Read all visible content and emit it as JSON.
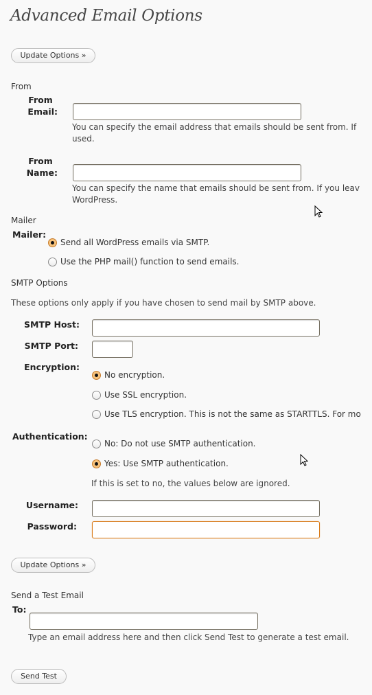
{
  "page": {
    "title": "Advanced Email Options"
  },
  "buttons": {
    "update_options_top": "Update Options »",
    "update_options_bottom": "Update Options »",
    "send_test": "Send Test"
  },
  "from_section": {
    "heading": "From",
    "from_email": {
      "label_line1": "From",
      "label_line2": "Email:",
      "value": "",
      "desc_line1": "You can specify the email address that emails should be sent from. If",
      "desc_line2": "used."
    },
    "from_name": {
      "label_line1": "From",
      "label_line2": "Name:",
      "value": "",
      "desc_line1": "You can specify the name that emails should be sent from. If you leav",
      "desc_line2": "WordPress."
    }
  },
  "mailer_section": {
    "heading": "Mailer",
    "label": "Mailer:",
    "options": [
      {
        "label": "Send all WordPress emails via SMTP.",
        "checked": true
      },
      {
        "label": "Use the PHP mail() function to send emails.",
        "checked": false
      }
    ]
  },
  "smtp_section": {
    "heading": "SMTP Options",
    "intro": "These options only apply if you have chosen to send mail by SMTP above.",
    "host": {
      "label": "SMTP Host:",
      "value": ""
    },
    "port": {
      "label": "SMTP Port:",
      "value": ""
    },
    "encryption": {
      "label": "Encryption:",
      "options": [
        {
          "label": "No encryption.",
          "checked": true
        },
        {
          "label": "Use SSL encryption.",
          "checked": false
        },
        {
          "label": "Use TLS encryption. This is not the same as STARTTLS. For mo",
          "checked": false
        }
      ]
    },
    "authentication": {
      "label": "Authentication:",
      "options": [
        {
          "label": "No: Do not use SMTP authentication.",
          "checked": false
        },
        {
          "label": "Yes: Use SMTP authentication.",
          "checked": true
        }
      ],
      "note": "If this is set to no, the values below are ignored."
    },
    "username": {
      "label": "Username:",
      "value": ""
    },
    "password": {
      "label": "Password:",
      "value": ""
    }
  },
  "test_section": {
    "heading": "Send a Test Email",
    "to_label": "To:",
    "to_value": "",
    "desc": "Type an email address here and then click Send Test to generate a test email."
  },
  "colors": {
    "background": "#f9f9f9",
    "focus_border": "#d87b1a",
    "radio_checked": "#f7c27b"
  }
}
